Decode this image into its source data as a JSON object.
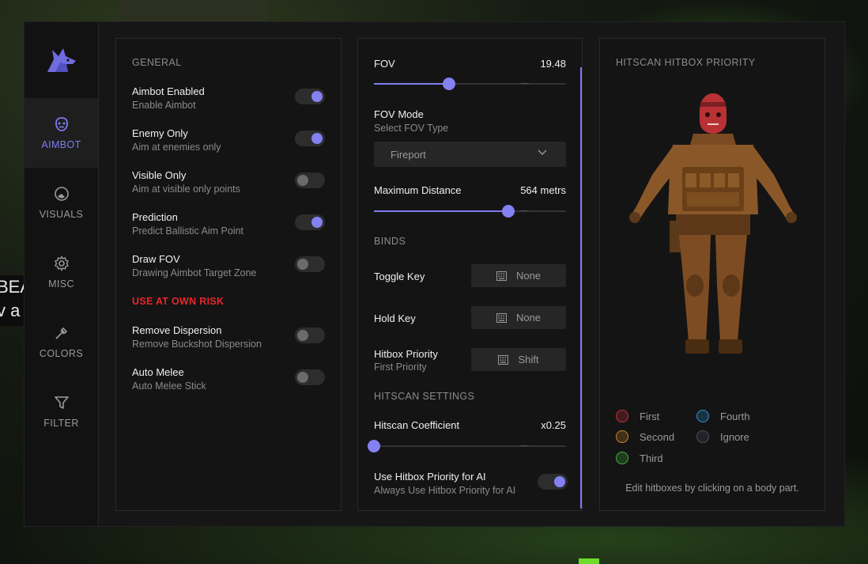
{
  "background": {
    "side_text": [
      "BEA",
      "v a"
    ]
  },
  "sidebar": {
    "logo_icon": "wolf-logo-icon",
    "items": [
      {
        "label": "AIMBOT",
        "icon": "mask-icon",
        "active": true
      },
      {
        "label": "VISUALS",
        "icon": "eye-icon",
        "active": false
      },
      {
        "label": "MISC",
        "icon": "gear-icon",
        "active": false
      },
      {
        "label": "COLORS",
        "icon": "eyedropper-icon",
        "active": false
      },
      {
        "label": "FILTER",
        "icon": "filter-icon",
        "active": false
      }
    ]
  },
  "general": {
    "title": "GENERAL",
    "options": [
      {
        "title": "Aimbot Enabled",
        "subtitle": "Enable Aimbot",
        "on": true
      },
      {
        "title": "Enemy Only",
        "subtitle": "Aim at enemies only",
        "on": true
      },
      {
        "title": "Visible Only",
        "subtitle": "Aim at visible only points",
        "on": false
      },
      {
        "title": "Prediction",
        "subtitle": "Predict Ballistic Aim Point",
        "on": true
      },
      {
        "title": "Draw FOV",
        "subtitle": "Drawing Aimbot Target Zone",
        "on": false
      }
    ],
    "risk_label": "USE AT OWN RISK",
    "risk_options": [
      {
        "title": "Remove Dispersion",
        "subtitle": "Remove Buckshot Dispersion",
        "on": false
      },
      {
        "title": "Auto Melee",
        "subtitle": "Auto Melee Stick",
        "on": false
      }
    ]
  },
  "settings": {
    "fov": {
      "label": "FOV",
      "value": "19.48",
      "fraction": 0.39
    },
    "fov_mode": {
      "title": "FOV Mode",
      "subtitle": "Select FOV Type",
      "selected": "Fireport"
    },
    "max_distance": {
      "label": "Maximum Distance",
      "value": "564 metrs",
      "fraction": 0.7
    },
    "binds_title": "BINDS",
    "binds": [
      {
        "label": "Toggle Key",
        "subtitle": "",
        "key": "None"
      },
      {
        "label": "Hold Key",
        "subtitle": "",
        "key": "None"
      },
      {
        "label": "Hitbox Priority",
        "subtitle": "First Priority",
        "key": "Shift"
      }
    ],
    "hitscan_title": "HITSCAN SETTINGS",
    "hitscan_coefficient": {
      "label": "Hitscan Coefficient",
      "value": "x0.25",
      "fraction": 0.0
    },
    "use_hitbox_ai": {
      "title": "Use Hitbox Priority for AI",
      "subtitle": "Always Use Hitbox Priority for AI",
      "on": true
    }
  },
  "hitbox": {
    "title": "HITSCAN HITBOX PRIORITY",
    "legend": [
      {
        "label": "First",
        "color": "#c8323c"
      },
      {
        "label": "Fourth",
        "color": "#2d8fd0"
      },
      {
        "label": "Second",
        "color": "#c8842d"
      },
      {
        "label": "Ignore",
        "color": "#4a5060"
      },
      {
        "label": "Third",
        "color": "#3fb23c"
      }
    ],
    "hint": "Edit hitboxes by clicking on a body part."
  },
  "colors": {
    "accent": "#7f7cf0",
    "risk": "#e8262b"
  }
}
